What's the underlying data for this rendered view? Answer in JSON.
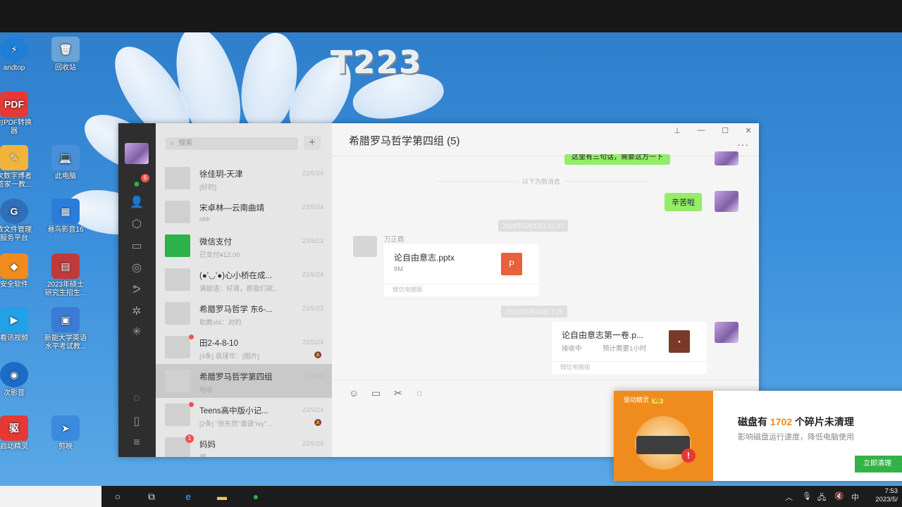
{
  "screen_label": "T223",
  "desktop_icons": [
    {
      "label": "andtop",
      "color": "#1f7fd6",
      "glyph": "⚡"
    },
    {
      "label": "回收站",
      "color": "#6aa3d6",
      "glyph": "🗑"
    },
    {
      "label": "为PDF转换\n器",
      "color": "#e53935",
      "glyph": "PDF"
    },
    {
      "label": "次数字博者\n签家一教...",
      "color": "#f0b43c",
      "glyph": "✎"
    },
    {
      "label": "此电脑",
      "color": "#4a90d9",
      "glyph": "💻"
    },
    {
      "label": "收文件管理\n服务平台",
      "color": "#2e6fb8",
      "glyph": "G"
    },
    {
      "label": "悬鸟影音16",
      "color": "#2a7ddb",
      "glyph": "▦"
    },
    {
      "label": "安全软件",
      "color": "#f08c1e",
      "glyph": "◆"
    },
    {
      "label": "2023年硕士\n研究生招生...",
      "color": "#c03a3a",
      "glyph": "▤"
    },
    {
      "label": "看讯视频",
      "color": "#22a1e6",
      "glyph": "▶"
    },
    {
      "label": "新能大学英语\n水平考试教...",
      "color": "#3a7bd5",
      "glyph": "▣"
    },
    {
      "label": "次影音",
      "color": "#1b6cc4",
      "glyph": "◉"
    },
    {
      "label": "启动精灵",
      "color": "#e53935",
      "glyph": "驱"
    },
    {
      "label": "剪映",
      "color": "#3a8be0",
      "glyph": "➤"
    }
  ],
  "wechat": {
    "search_placeholder": "搜索",
    "nav_badge": "6",
    "window_title": "希腊罗马哲学第四组 (5)",
    "conversations": [
      {
        "name": "徐佳玥-天津",
        "preview": "[好的]",
        "time": "23/5/24",
        "avatar": "default",
        "dot": false,
        "badge": "",
        "active": false
      },
      {
        "name": "宋卓林—云南曲靖",
        "preview": "okk",
        "time": "23/5/24",
        "avatar": "default",
        "dot": false,
        "badge": "",
        "active": false
      },
      {
        "name": "微信支付",
        "preview": "已支付¥12.00",
        "time": "23/5/23",
        "avatar": "wxpay",
        "dot": false,
        "badge": "",
        "active": false
      },
      {
        "name": "(●'◡'●)心小桥在成...",
        "preview": "满姐语：好滴，那我们就...",
        "time": "23/5/24",
        "avatar": "default",
        "dot": false,
        "badge": "",
        "active": false
      },
      {
        "name": "希腊罗马哲学 东6-...",
        "preview": "助教xbl：对的",
        "time": "23/5/23",
        "avatar": "default",
        "dot": false,
        "badge": "",
        "active": false
      },
      {
        "name": "田2-4-8-10",
        "preview": "[4条] 袁瑾华：[图片]",
        "time": "23/5/24",
        "avatar": "default",
        "dot": true,
        "badge": "",
        "active": false
      },
      {
        "name": "希腊罗马哲学第四组",
        "preview": "哈哈",
        "time": "23/5/24",
        "avatar": "default",
        "dot": false,
        "badge": "",
        "active": true
      },
      {
        "name": "Teens高中版小记...",
        "preview": "[2条] \"张东然\"邀请\"ivy\"...",
        "time": "23/5/24",
        "avatar": "default",
        "dot": true,
        "badge": "",
        "active": false
      },
      {
        "name": "妈妈",
        "preview": "嗯",
        "time": "23/5/24",
        "avatar": "default",
        "dot": false,
        "badge": "1",
        "active": false
      }
    ],
    "messages": {
      "top_bubble": "这里有三句话，需要这方一下",
      "new_divider": "以下为新消息",
      "thanks_bubble": "辛苦啦",
      "time1": "2023年5月23日 22:47",
      "sender": "万正鼎",
      "file1_name": "论自由意志.pptx",
      "file1_size": "8M",
      "file1_source": "微信电脑版",
      "time2": "2023年5月24日 7:25",
      "file2_name": "论自由意志第一卷.p...",
      "file2_status": "接收中",
      "file2_eta": "预计需要1小时",
      "file2_source": "微信电脑版"
    },
    "toolbar_icons": [
      "emoji-icon",
      "folder-icon",
      "scissors-icon",
      "chat-bubble-icon"
    ]
  },
  "popup": {
    "brand": "驱动精灵",
    "vip": "Vip",
    "title_prefix": "磁盘有",
    "title_count": "1702",
    "title_suffix": "个碎片未清理",
    "subtitle": "影响磁盘运行速度，降低电脑使用",
    "button": "立即清理"
  },
  "taskbar": {
    "ime": "中",
    "time": "7:53",
    "date": "2023/5/"
  }
}
